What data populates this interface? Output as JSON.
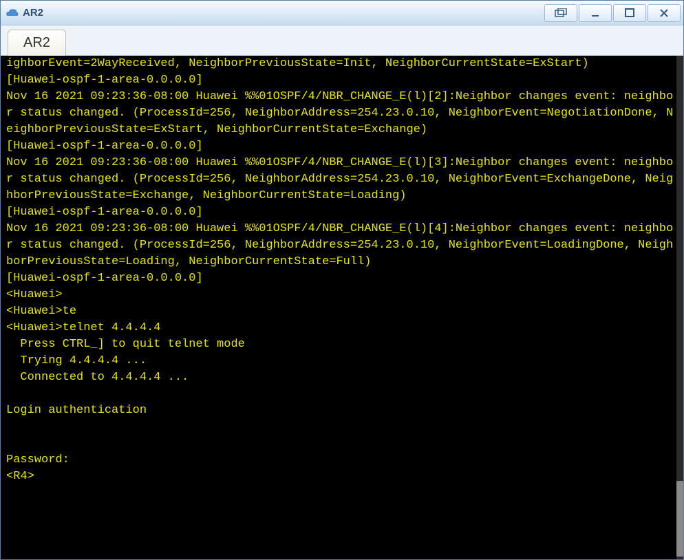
{
  "window": {
    "title": "AR2"
  },
  "tabs": [
    {
      "label": "AR2"
    }
  ],
  "colors": {
    "terminal_bg": "#000000",
    "terminal_fg": "#e6e600",
    "titlebar_text": "#2b4f77"
  },
  "terminal": {
    "lines": [
      "ighborEvent=2WayReceived, NeighborPreviousState=Init, NeighborCurrentState=ExStart)",
      "[Huawei-ospf-1-area-0.0.0.0]",
      "Nov 16 2021 09:23:36-08:00 Huawei %%01OSPF/4/NBR_CHANGE_E(l)[2]:Neighbor changes event: neighbor status changed. (ProcessId=256, NeighborAddress=254.23.0.10, NeighborEvent=NegotiationDone, NeighborPreviousState=ExStart, NeighborCurrentState=Exchange)",
      "[Huawei-ospf-1-area-0.0.0.0]",
      "Nov 16 2021 09:23:36-08:00 Huawei %%01OSPF/4/NBR_CHANGE_E(l)[3]:Neighbor changes event: neighbor status changed. (ProcessId=256, NeighborAddress=254.23.0.10, NeighborEvent=ExchangeDone, NeighborPreviousState=Exchange, NeighborCurrentState=Loading)",
      "[Huawei-ospf-1-area-0.0.0.0]",
      "Nov 16 2021 09:23:36-08:00 Huawei %%01OSPF/4/NBR_CHANGE_E(l)[4]:Neighbor changes event: neighbor status changed. (ProcessId=256, NeighborAddress=254.23.0.10, NeighborEvent=LoadingDone, NeighborPreviousState=Loading, NeighborCurrentState=Full)",
      "[Huawei-ospf-1-area-0.0.0.0]",
      "<Huawei>",
      "<Huawei>te",
      "<Huawei>telnet 4.4.4.4",
      "  Press CTRL_] to quit telnet mode",
      "  Trying 4.4.4.4 ...",
      "  Connected to 4.4.4.4 ...",
      "",
      "Login authentication",
      "",
      "",
      "Password:",
      "<R4>"
    ]
  }
}
